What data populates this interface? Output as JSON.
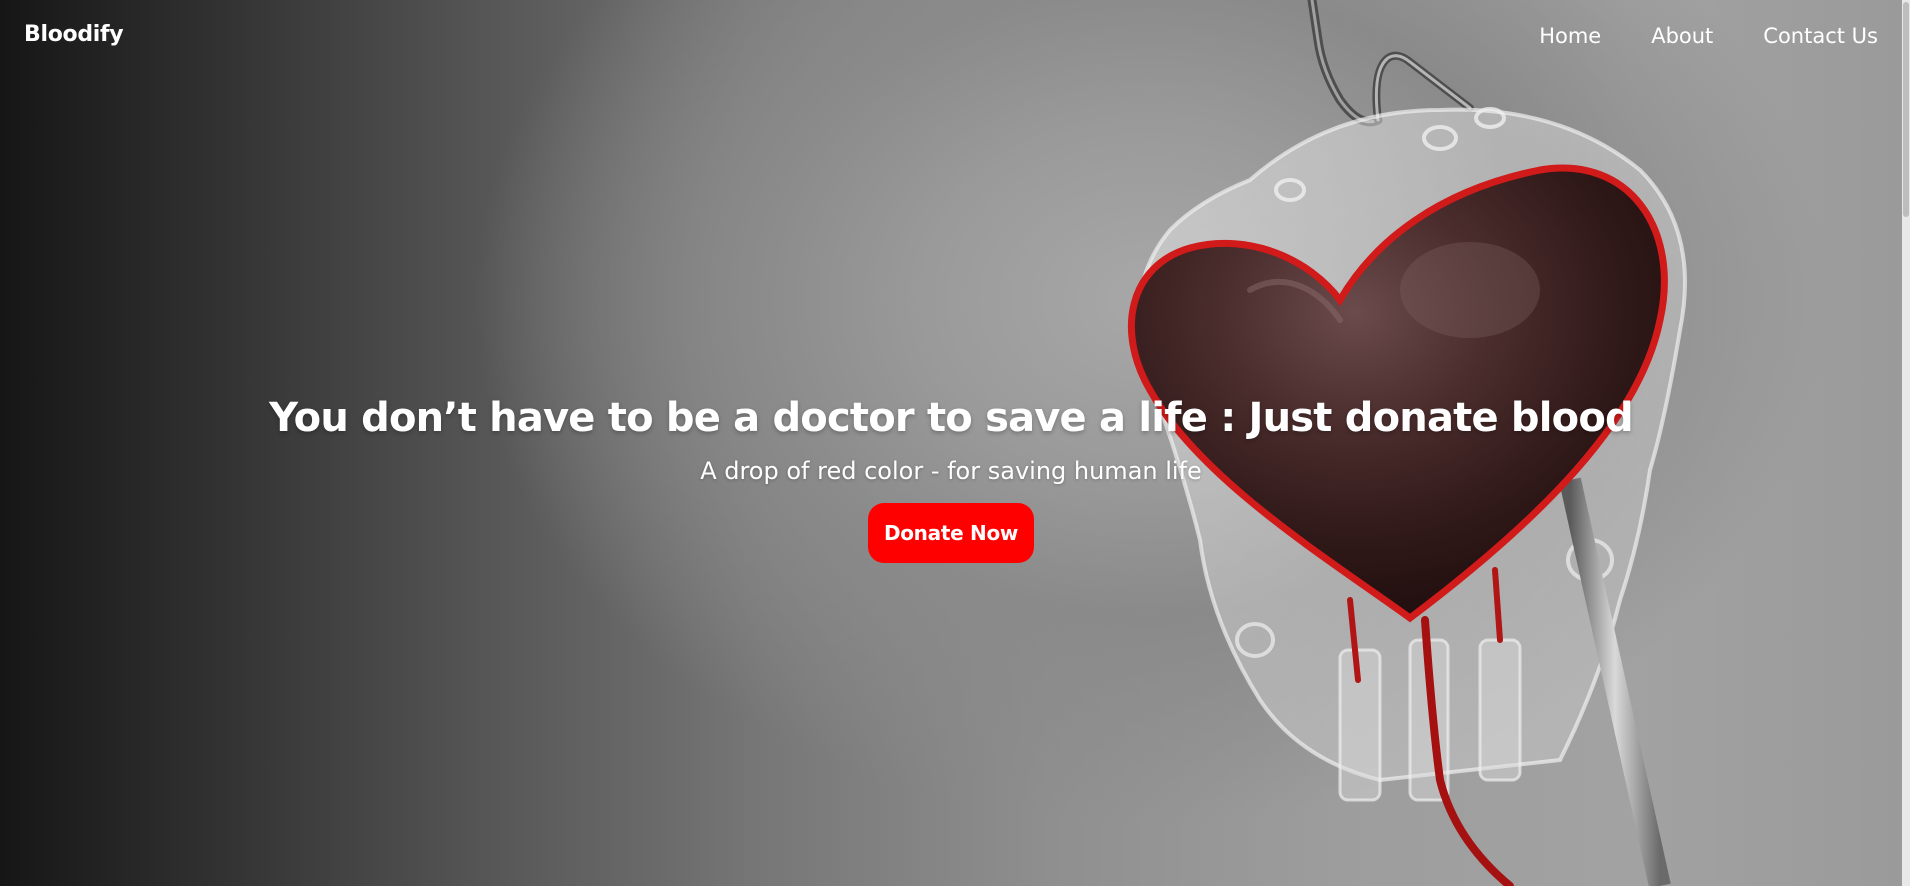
{
  "navbar": {
    "brand": "Bloodify",
    "links": [
      {
        "label": "Home"
      },
      {
        "label": "About"
      },
      {
        "label": "Contact Us"
      }
    ]
  },
  "hero": {
    "headline": "You don’t have to be a doctor to save a life : Just donate blood",
    "subline": "A drop of red color - for saving human life",
    "cta_label": "Donate Now",
    "illustration_icon": "blood-bag-heart-icon"
  },
  "colors": {
    "accent": "#ff0000",
    "text": "#ffffff"
  }
}
